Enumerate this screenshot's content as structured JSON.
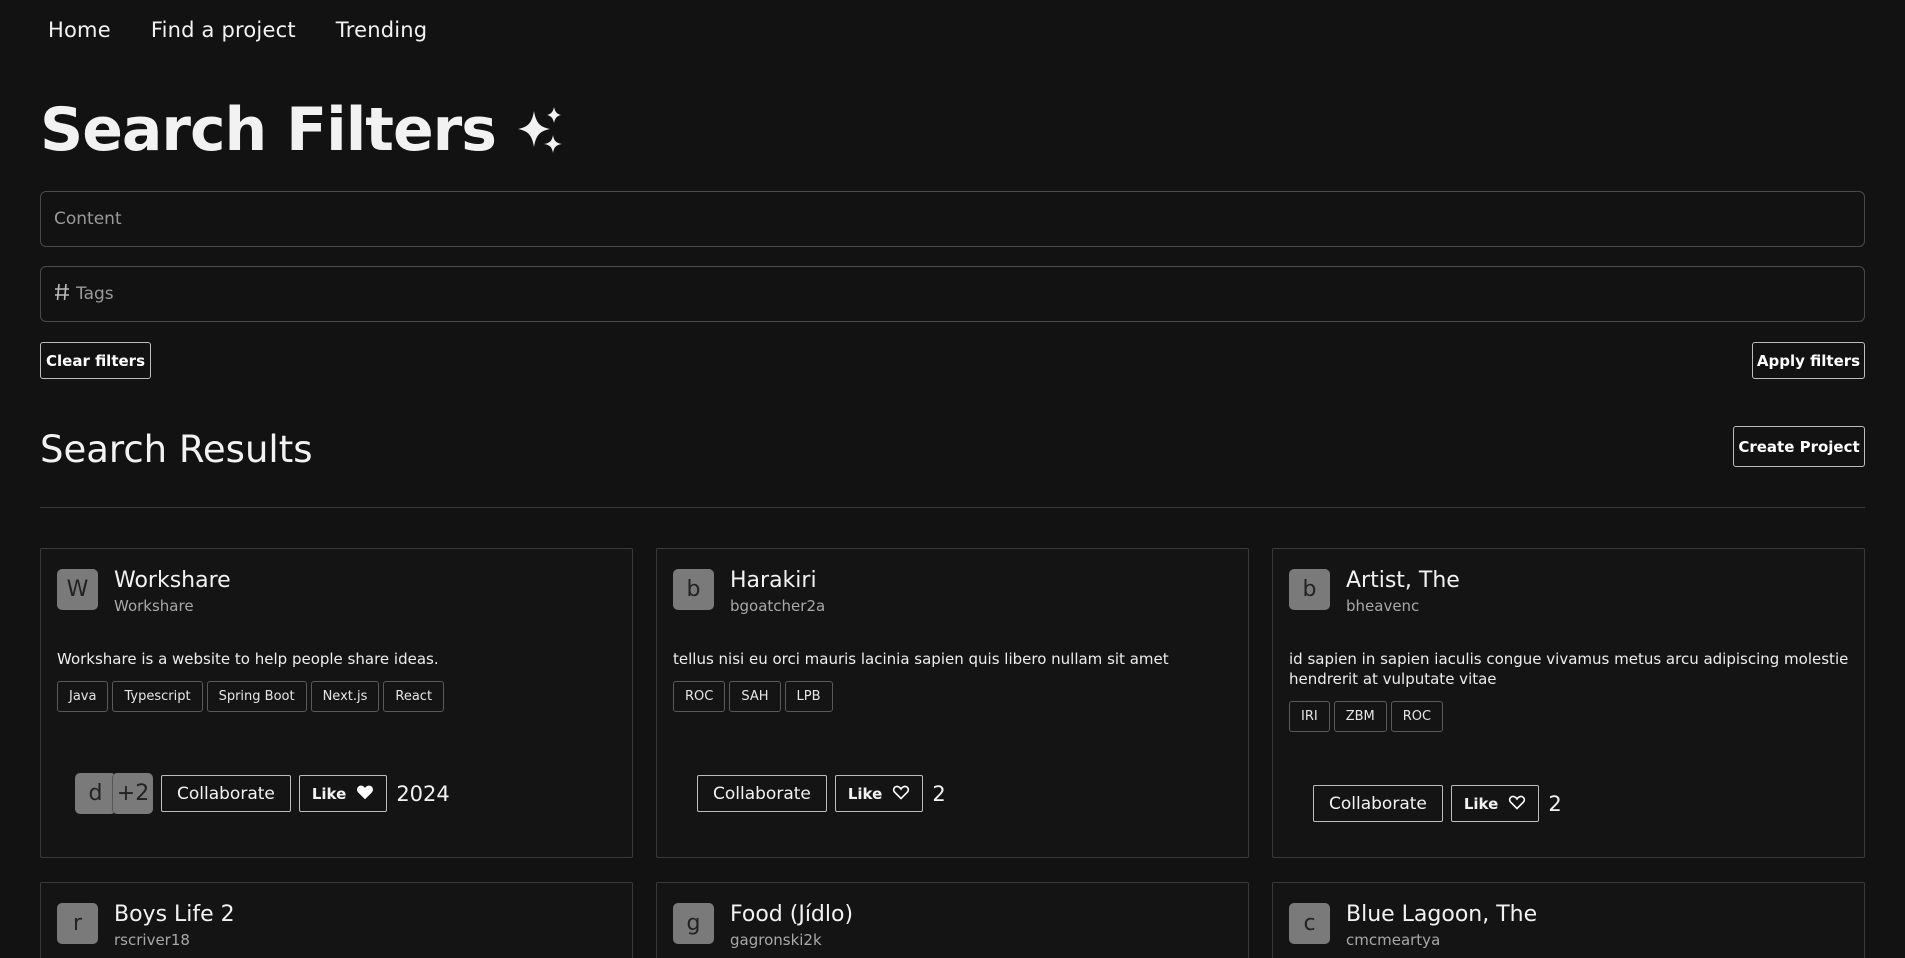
{
  "nav": [
    {
      "label": "Home"
    },
    {
      "label": "Find a project"
    },
    {
      "label": "Trending"
    }
  ],
  "filters": {
    "title": "Search Filters",
    "title_icon": "sparkles-icon",
    "content_placeholder": "Content",
    "tags_placeholder": "Tags",
    "tags_icon": "hash-icon",
    "clear_label": "Clear filters",
    "apply_label": "Apply filters"
  },
  "results": {
    "title": "Search Results",
    "create_label": "Create Project"
  },
  "projects": [
    {
      "initial": "W",
      "title": "Workshare",
      "author": "Workshare",
      "description": "Workshare is a website to help people share ideas.",
      "tags": [
        "Java",
        "Typescript",
        "Spring Boot",
        "Next.js",
        "React"
      ],
      "collaborators": [
        "d",
        "+2"
      ],
      "collaborate_label": "Collaborate",
      "like_label": "Like",
      "liked": true,
      "likes": "2024"
    },
    {
      "initial": "b",
      "title": "Harakiri",
      "author": "bgoatcher2a",
      "description": "tellus nisi eu orci mauris lacinia sapien quis libero nullam sit amet",
      "tags": [
        "ROC",
        "SAH",
        "LPB"
      ],
      "collaborate_label": "Collaborate",
      "like_label": "Like",
      "liked": false,
      "likes": "2"
    },
    {
      "initial": "b",
      "title": "Artist, The",
      "author": "bheavenc",
      "description": "id sapien in sapien iaculis congue vivamus metus arcu adipiscing molestie hendrerit at vulputate vitae",
      "tags": [
        "IRI",
        "ZBM",
        "ROC"
      ],
      "collaborate_label": "Collaborate",
      "like_label": "Like",
      "liked": false,
      "likes": "2"
    },
    {
      "initial": "r",
      "title": "Boys Life 2",
      "author": "rscriver18"
    },
    {
      "initial": "g",
      "title": "Food (Jídlo)",
      "author": "gagronski2k"
    },
    {
      "initial": "c",
      "title": "Blue Lagoon, The",
      "author": "cmcmeartya"
    }
  ],
  "colors": {
    "background": "#121212",
    "border": "#3a3a3a",
    "avatar": "#7a7a7a"
  }
}
